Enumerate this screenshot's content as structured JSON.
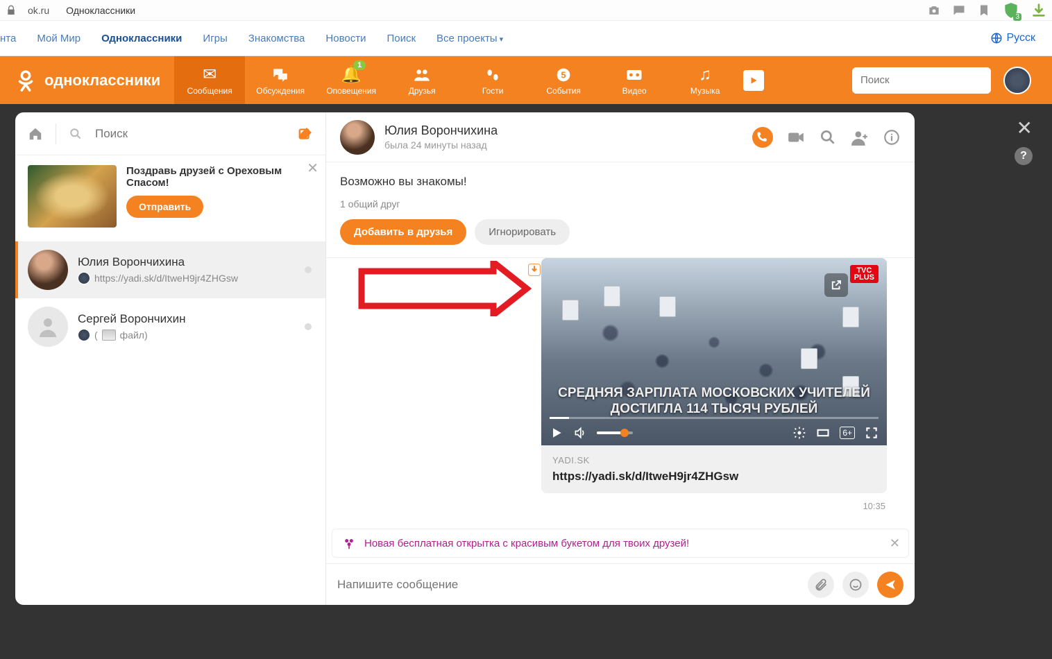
{
  "browser": {
    "host": "ok.ru",
    "title": "Одноклассники",
    "shield_badge": "3"
  },
  "topnav": {
    "items": [
      "нта",
      "Мой Мир",
      "Одноклассники",
      "Игры",
      "Знакомства",
      "Новости",
      "Поиск",
      "Все проекты"
    ],
    "active_index": 2,
    "lang": "Русск"
  },
  "orangebar": {
    "logo": "одноклассники",
    "tabs": [
      {
        "label": "Сообщения",
        "icon": "envelope",
        "selected": true
      },
      {
        "label": "Обсуждения",
        "icon": "comments"
      },
      {
        "label": "Оповещения",
        "icon": "bell",
        "badge": "1"
      },
      {
        "label": "Друзья",
        "icon": "users"
      },
      {
        "label": "Гости",
        "icon": "footprints"
      },
      {
        "label": "События",
        "icon": "star5"
      },
      {
        "label": "Видео",
        "icon": "video-reel"
      },
      {
        "label": "Музыка",
        "icon": "music-note"
      }
    ],
    "search_placeholder": "Поиск"
  },
  "sidebar": {
    "search_placeholder": "Поиск",
    "promo": {
      "text": "Поздравь друзей с Ореховым Спасом!",
      "button": "Отправить"
    },
    "chats": [
      {
        "name": "Юлия Ворончихина",
        "sub": "https://yadi.sk/d/ItweH9jr4ZHGsw",
        "active": true,
        "avatar": "girl"
      },
      {
        "name": "Сергей Ворончихин",
        "sub": "файл)",
        "active": false,
        "avatar": "blank",
        "prefix": "("
      }
    ]
  },
  "conversation": {
    "name": "Юлия Ворончихина",
    "last_seen": "была 24 минуты назад",
    "suggest_title": "Возможно вы знакомы!",
    "suggest_sub": "1 общий друг",
    "btn_add": "Добавить в друзья",
    "btn_ignore": "Игнорировать",
    "video_caption": "СРЕДНЯЯ ЗАРПЛАТА МОСКОВСКИХ УЧИТЕЛЕЙ ДОСТИГЛА 114 ТЫСЯЧ РУБЛЕЙ",
    "tvc_label": "PLUS",
    "quality": "6+",
    "link_host": "YADI.SK",
    "link_url": "https://yadi.sk/d/ItweH9jr4ZHGsw",
    "time": "10:35",
    "hint_text": "Новая бесплатная открытка с красивым букетом для твоих друзей!",
    "compose_placeholder": "Напишите сообщение"
  }
}
